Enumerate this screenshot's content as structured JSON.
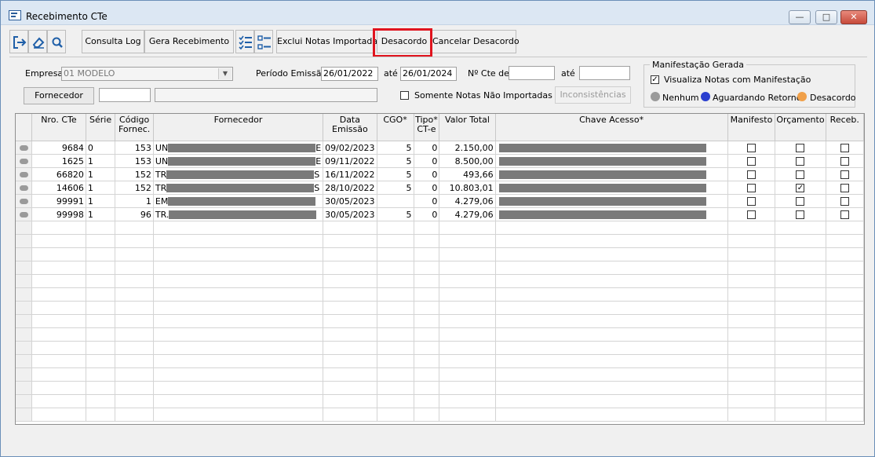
{
  "window": {
    "title": "Recebimento CTe"
  },
  "toolbar": {
    "consulta_log": "Consulta Log",
    "gera_recebimento": "Gera Recebimento",
    "exclui_notas": "Exclui Notas Importadas",
    "desacordo": "Desacordo",
    "cancelar_desacordo": "Cancelar Desacordo"
  },
  "filters": {
    "empresa_label": "Empresa",
    "empresa_value": "01 MODELO",
    "fornecedor_button": "Fornecedor",
    "fornecedor_code": "",
    "fornecedor_name": "",
    "periodo_label": "Período Emissão",
    "periodo_from": "26/01/2022",
    "periodo_ate_label": "até",
    "periodo_to": "26/01/2024",
    "cte_label": "Nº Cte de",
    "cte_from": "",
    "cte_ate_label": "até",
    "cte_to": "",
    "somente_label": "Somente Notas Não Importadas",
    "somente_checked": false,
    "inconsistencias_button": "Inconsistências"
  },
  "manifestacao": {
    "group_title": "Manifestação Gerada",
    "visualiza_label": "Visualiza Notas com Manifestação",
    "visualiza_checked": true,
    "legend": [
      {
        "label": "Nenhum",
        "color": "#9a9a9a"
      },
      {
        "label": "Aguardando Retorno",
        "color": "#2a3fcf"
      },
      {
        "label": "Desacordo",
        "color": "#f0a04a"
      }
    ]
  },
  "grid": {
    "columns": [
      "Nro. CTe",
      "Série",
      "Código\nFornec.",
      "Fornecedor",
      "Data\nEmissão",
      "CGO*",
      "Tipo*\nCT-e",
      "Valor Total",
      "Chave Acesso*",
      "Manifesto",
      "Orçamento",
      "Receb."
    ],
    "rows": [
      {
        "nro": "9684",
        "serie": "0",
        "codigo": "153",
        "fornecedor_prefix": "UN",
        "fornecedor_suffix": "E",
        "data": "09/02/2023",
        "cgo": "5",
        "tipo": "0",
        "valor": "2.150,00",
        "manifesto": false,
        "orcamento": false,
        "receb": false
      },
      {
        "nro": "1625",
        "serie": "1",
        "codigo": "153",
        "fornecedor_prefix": "UN",
        "fornecedor_suffix": "E",
        "data": "09/11/2022",
        "cgo": "5",
        "tipo": "0",
        "valor": "8.500,00",
        "manifesto": false,
        "orcamento": false,
        "receb": false
      },
      {
        "nro": "66820",
        "serie": "1",
        "codigo": "152",
        "fornecedor_prefix": "TR",
        "fornecedor_suffix": "S",
        "data": "16/11/2022",
        "cgo": "5",
        "tipo": "0",
        "valor": "493,66",
        "manifesto": false,
        "orcamento": false,
        "receb": false
      },
      {
        "nro": "14606",
        "serie": "1",
        "codigo": "152",
        "fornecedor_prefix": "TR",
        "fornecedor_suffix": "S",
        "data": "28/10/2022",
        "cgo": "5",
        "tipo": "0",
        "valor": "10.803,01",
        "manifesto": false,
        "orcamento": true,
        "receb": false
      },
      {
        "nro": "99991",
        "serie": "1",
        "codigo": "1",
        "fornecedor_prefix": "EM",
        "fornecedor_suffix": "",
        "data": "30/05/2023",
        "cgo": "",
        "tipo": "0",
        "valor": "4.279,06",
        "manifesto": false,
        "orcamento": false,
        "receb": false
      },
      {
        "nro": "99998",
        "serie": "1",
        "codigo": "96",
        "fornecedor_prefix": "TR.",
        "fornecedor_suffix": "",
        "data": "30/05/2023",
        "cgo": "5",
        "tipo": "0",
        "valor": "4.279,06",
        "manifesto": false,
        "orcamento": false,
        "receb": false
      }
    ]
  },
  "colors": {
    "highlight": "#e0141e"
  }
}
